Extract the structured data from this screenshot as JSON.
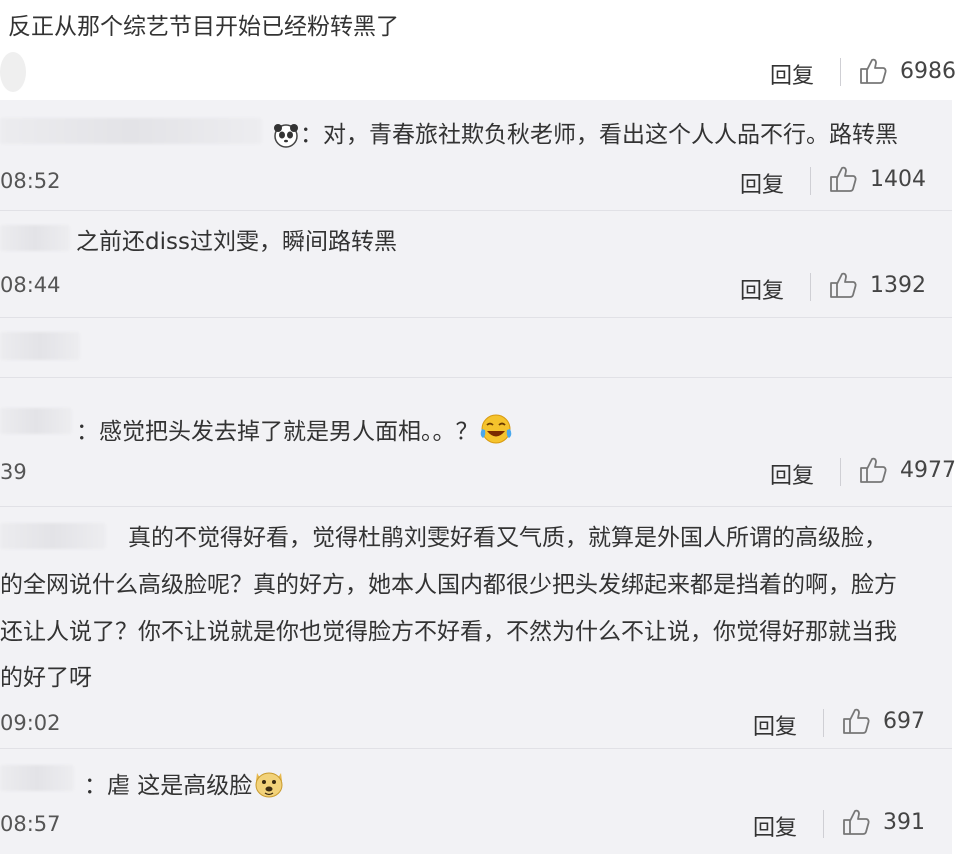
{
  "main_comment": {
    "text": "反正从那个综艺节目开始已经粉转黑了",
    "reply_label": "回复",
    "likes": "6986"
  },
  "replies": [
    {
      "text": "：对，青春旅社欺负秋老师，看出这个人人品不行。路转黑",
      "time": "08:52",
      "reply_label": "回复",
      "likes": "1404",
      "emoji": "panda-icon"
    },
    {
      "text": "之前还diss过刘雯，瞬间路转黑",
      "time": "08:44",
      "reply_label": "回复",
      "likes": "1392"
    },
    {
      "text": "：感觉把头发去掉了就是男人面相。。？",
      "time": "39",
      "reply_label": "回复",
      "likes": "4977",
      "emoji": "laugh-cry-icon"
    },
    {
      "lines": [
        "真的不觉得好看，觉得杜鹃刘雯好看又气质，就算是外国人所谓的高级脸，",
        "的全网说什么高级脸呢？真的好方，她本人国内都很少把头发绑起来都是挡着的啊，脸方",
        "还让人说了？你不让说就是你也觉得脸方不好看，不然为什么不让说，你觉得好那就当我",
        "的好了呀"
      ],
      "time": "09:02",
      "reply_label": "回复",
      "likes": "697"
    },
    {
      "text": "：虐 这是高级脸",
      "time": "08:57",
      "reply_label": "回复",
      "likes": "391",
      "emoji": "doge-icon"
    }
  ]
}
